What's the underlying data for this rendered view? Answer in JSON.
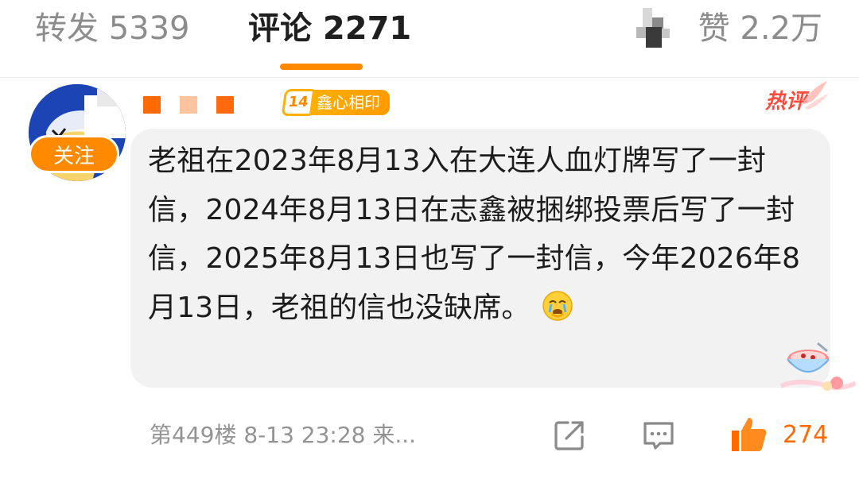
{
  "tabs": {
    "forward": "转发 5339",
    "comment": "评论 2271",
    "like": "赞 2.2万"
  },
  "colors": {
    "accent": "#ff8a00",
    "hot": "#ff4a3d",
    "bubble": "#f2f2f2",
    "meta_text": "#939393"
  },
  "comment": {
    "follow_label": "关注",
    "badge": {
      "level": "14",
      "text": "鑫心相印"
    },
    "hot_label": "热评",
    "text": "老祖在2023年8月13入在大连人血灯牌写了一封信，2024年8月13日在志鑫被捆绑投票后写了一封信，2025年8月13日也写了一封信，今年2026年8月13日，老祖的信也没缺席。",
    "emoji": "crying-face-emoji",
    "floor_and_time": "第449楼 8-13 23:28 来...",
    "like_count": "274"
  },
  "icons": {
    "share": "share-icon",
    "reply": "comment-icon",
    "like": "thumbs-up-icon"
  }
}
